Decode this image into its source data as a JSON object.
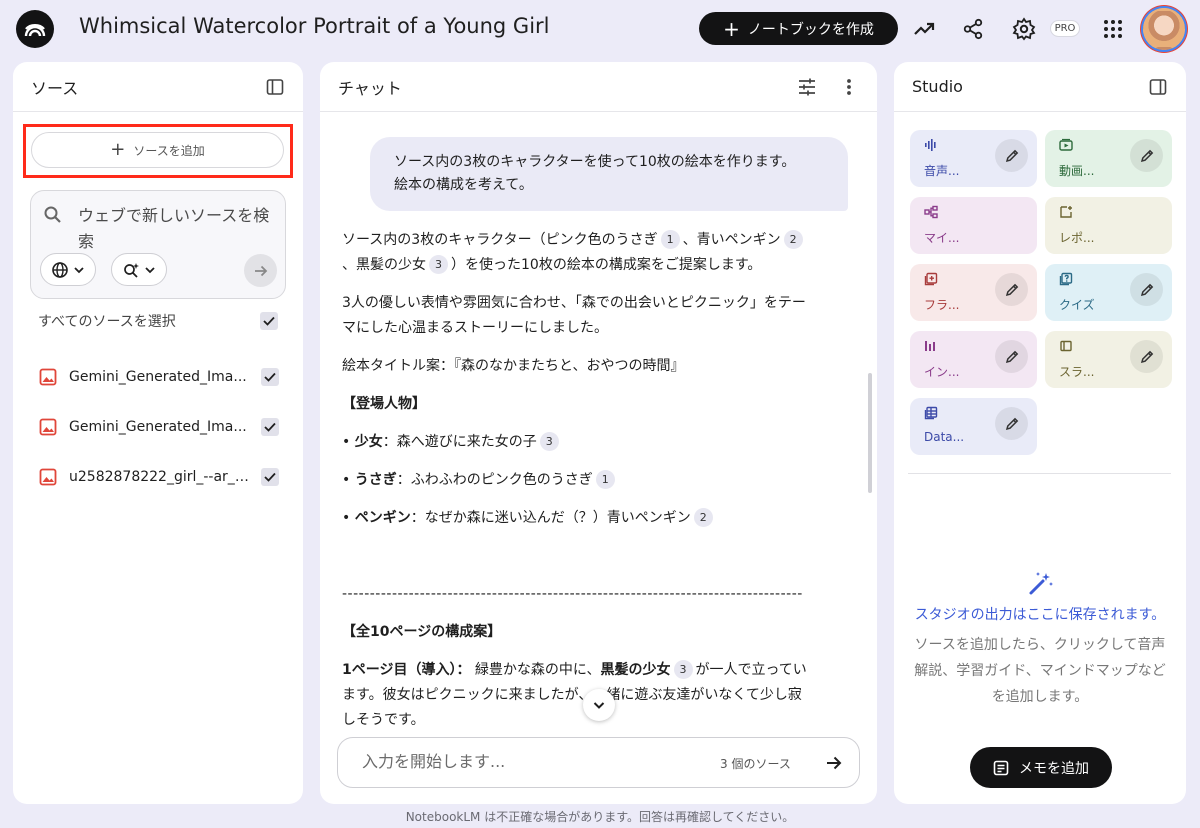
{
  "header": {
    "title": "Whimsical Watercolor Portrait of a Young Girl",
    "create_notebook_label": "ノートブックを作成",
    "pro_badge": "PRO"
  },
  "sources": {
    "title": "ソース",
    "add_source_label": "ソースを追加",
    "web_search_placeholder": "ウェブで新しいソースを検索",
    "select_all_label": "すべてのソースを選択",
    "items": [
      {
        "name": "Gemini_Generated_Ima...",
        "checked": true
      },
      {
        "name": "Gemini_Generated_Ima...",
        "checked": true
      },
      {
        "name": "u2582878222_girl_--ar_2...",
        "checked": true
      }
    ]
  },
  "chat": {
    "title": "チャット",
    "user_message_line1": "ソース内の3枚のキャラクターを使って10枚の絵本を作ります。",
    "user_message_line2": "絵本の構成を考えて。",
    "answer": {
      "p1_a": "ソース内の3枚のキャラクター（ピンク色のうさぎ",
      "p1_cite1": "1",
      "p1_b": "、青いペンギン",
      "p1_cite2": "2",
      "p1_c": "、黒髪の少女",
      "p1_cite3": "3",
      "p1_d": "）を使った10枚の絵本の構成案をご提案します。",
      "p2": "3人の優しい表情や雰囲気に合わせ、「森での出会いとピクニック」をテーマにした心温まるストーリーにしました。",
      "p3": "絵本タイトル案：『森のなかまたちと、おやつの時間』",
      "cast_heading": "【登場人物】",
      "cast": [
        {
          "bullet": "• ",
          "name": "少女",
          "desc": "：森へ遊びに来た女の子",
          "cite": "3"
        },
        {
          "bullet": "• ",
          "name": "うさぎ",
          "desc": "：ふわふわのピンク色のうさぎ",
          "cite": "1"
        },
        {
          "bullet": "• ",
          "name": "ペンギン",
          "desc": "：なぜか森に迷い込んだ（？）青いペンギン",
          "cite": "2"
        }
      ],
      "separator": "-----------------------------------------------------------------------------------",
      "pages_heading": "【全10ページの構成案】",
      "page1_label": "1ページ目（導入）：",
      "page1_a": " 緑豊かな森の中に、",
      "page1_bold": "黒髪の少女",
      "page1_cite": "3",
      "page1_b": "が一人で立っています。彼女はピクニックに来ましたが、一緒に遊ぶ友達がいなくて少し寂しそうです。"
    },
    "input_placeholder": "入力を開始します...",
    "source_count": "3 個のソース"
  },
  "studio": {
    "title": "Studio",
    "tiles": [
      {
        "label": "音声...",
        "icon": "audio-icon",
        "bg": "#e9ebf8",
        "fg": "#3c4aa8",
        "edit": true
      },
      {
        "label": "動画...",
        "icon": "video-icon",
        "bg": "#e3f2e6",
        "fg": "#2e6b3c",
        "edit": true
      },
      {
        "label": "マイ...",
        "icon": "mindmap-icon",
        "bg": "#f3e7f3",
        "fg": "#8a3c8a",
        "edit": false
      },
      {
        "label": "レポ...",
        "icon": "report-icon",
        "bg": "#f2f1e4",
        "fg": "#6b6430",
        "edit": false
      },
      {
        "label": "フラ...",
        "icon": "flashcard-icon",
        "bg": "#f8e9e9",
        "fg": "#a83c3c",
        "edit": true
      },
      {
        "label": "クイズ",
        "icon": "quiz-icon",
        "bg": "#dff0f6",
        "fg": "#2b6a86",
        "edit": true
      },
      {
        "label": "イン...",
        "icon": "infographic-icon",
        "bg": "#f3e7f3",
        "fg": "#8a3c8a",
        "edit": true
      },
      {
        "label": "スラ...",
        "icon": "slides-icon",
        "bg": "#f2f1e4",
        "fg": "#6b6430",
        "edit": true
      },
      {
        "label": "Data...",
        "icon": "table-icon",
        "bg": "#e9ebf8",
        "fg": "#3c4aa8",
        "edit": true
      }
    ],
    "empty_title": "スタジオの出力はここに保存されます。",
    "empty_desc": "ソースを追加したら、クリックして音声解説、学習ガイド、マインドマップなどを追加します。",
    "add_memo_label": "メモを追加"
  },
  "footer": {
    "disclaimer": "NotebookLM は不正確な場合があります。回答は再確認してください。"
  }
}
